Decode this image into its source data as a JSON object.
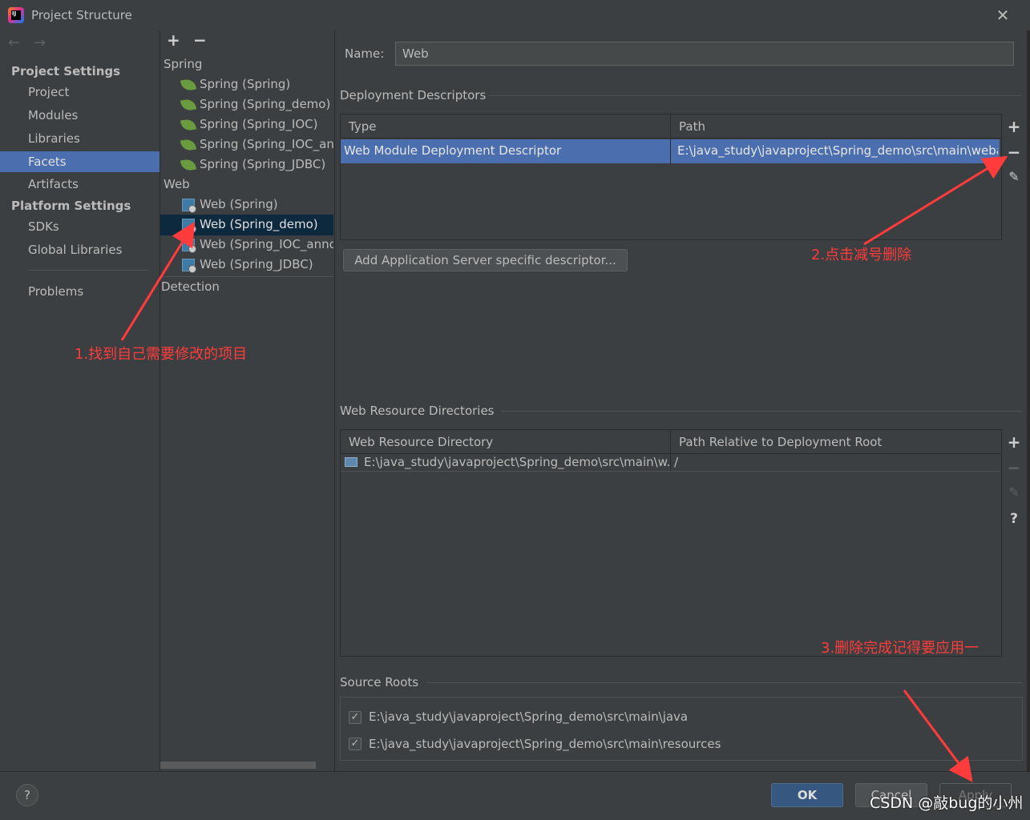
{
  "window": {
    "title": "Project Structure"
  },
  "nav": {
    "back": "←",
    "forward": "→"
  },
  "left": {
    "project_settings": "Project Settings",
    "items": [
      "Project",
      "Modules",
      "Libraries",
      "Facets",
      "Artifacts"
    ],
    "platform_settings": "Platform Settings",
    "platform_items": [
      "SDKs",
      "Global Libraries"
    ],
    "problems": "Problems"
  },
  "mid": {
    "plus": "+",
    "minus": "−",
    "spring_group": "Spring",
    "spring_items": [
      "Spring (Spring)",
      "Spring (Spring_demo)",
      "Spring (Spring_IOC)",
      "Spring (Spring_IOC_anr",
      "Spring (Spring_JDBC)"
    ],
    "web_group": "Web",
    "web_items": [
      "Web (Spring)",
      "Web (Spring_demo)",
      "Web (Spring_IOC_anno",
      "Web (Spring_JDBC)"
    ],
    "detection": "Detection"
  },
  "right": {
    "name_label": "Name:",
    "name_value": "Web",
    "dd_title": "Deployment Descriptors",
    "dd_col_type": "Type",
    "dd_col_path": "Path",
    "dd_row_type": "Web Module Deployment Descriptor",
    "dd_row_path": "E:\\java_study\\javaproject\\Spring_demo\\src\\main\\webap",
    "add_desc_btn": "Add Application Server specific descriptor...",
    "wr_title": "Web Resource Directories",
    "wr_col_dir": "Web Resource Directory",
    "wr_col_rel": "Path Relative to Deployment Root",
    "wr_row_dir": "E:\\java_study\\javaproject\\Spring_demo\\src\\main\\w...",
    "wr_row_rel": "/",
    "question": "?",
    "sr_title": "Source Roots",
    "sr_items": [
      "E:\\java_study\\javaproject\\Spring_demo\\src\\main\\java",
      "E:\\java_study\\javaproject\\Spring_demo\\src\\main\\resources"
    ]
  },
  "footer": {
    "help": "?",
    "ok": "OK",
    "cancel": "Cancel",
    "apply": "Apply"
  },
  "annotations": {
    "a1": "1.找到自己需要修改的项目",
    "a2": "2.点击减号删除",
    "a3": "3.删除完成记得要应用一"
  },
  "watermark": "CSDN @敲bug的小州",
  "colors": {
    "selection": "#4b6eaf",
    "annotation": "#ff3b3b",
    "ok_button": "#365880"
  }
}
